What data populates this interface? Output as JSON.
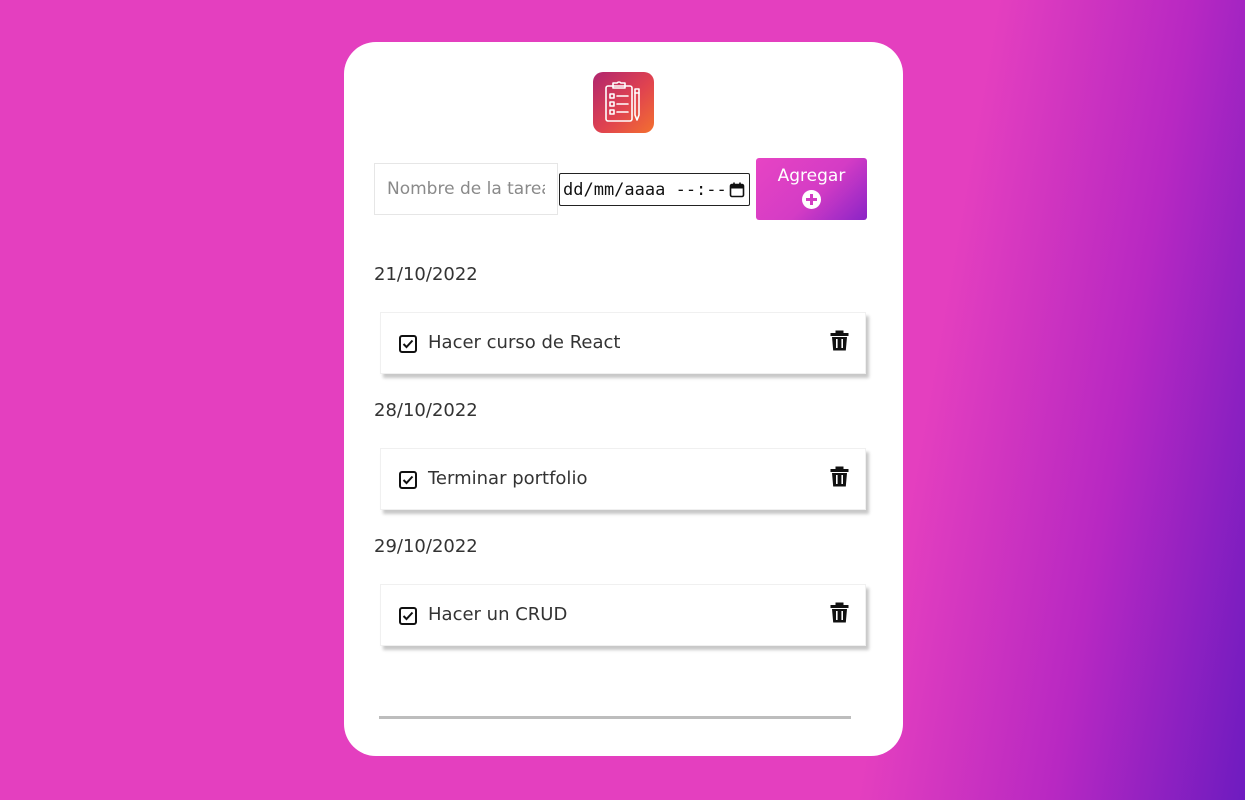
{
  "app": {
    "logo_icon": "clipboard-icon"
  },
  "form": {
    "task_placeholder": "Nombre de la tarea",
    "date_placeholder": "dd/mm/aaaa --:--",
    "add_label": "Agregar",
    "add_icon": "plus-circle-icon"
  },
  "groups": [
    {
      "date": "21/10/2022",
      "tasks": [
        {
          "label": "Hacer curso de React",
          "done": true
        }
      ]
    },
    {
      "date": "28/10/2022",
      "tasks": [
        {
          "label": "Terminar portfolio",
          "done": true
        }
      ]
    },
    {
      "date": "29/10/2022",
      "tasks": [
        {
          "label": "Hacer un CRUD",
          "done": true
        }
      ]
    }
  ],
  "colors": {
    "background": "#e43fbf",
    "background_end": "#6e1bc0",
    "button_start": "#e744c4",
    "button_end": "#8a24c6",
    "logo_start": "#b0266f",
    "logo_end": "#f3702f"
  }
}
